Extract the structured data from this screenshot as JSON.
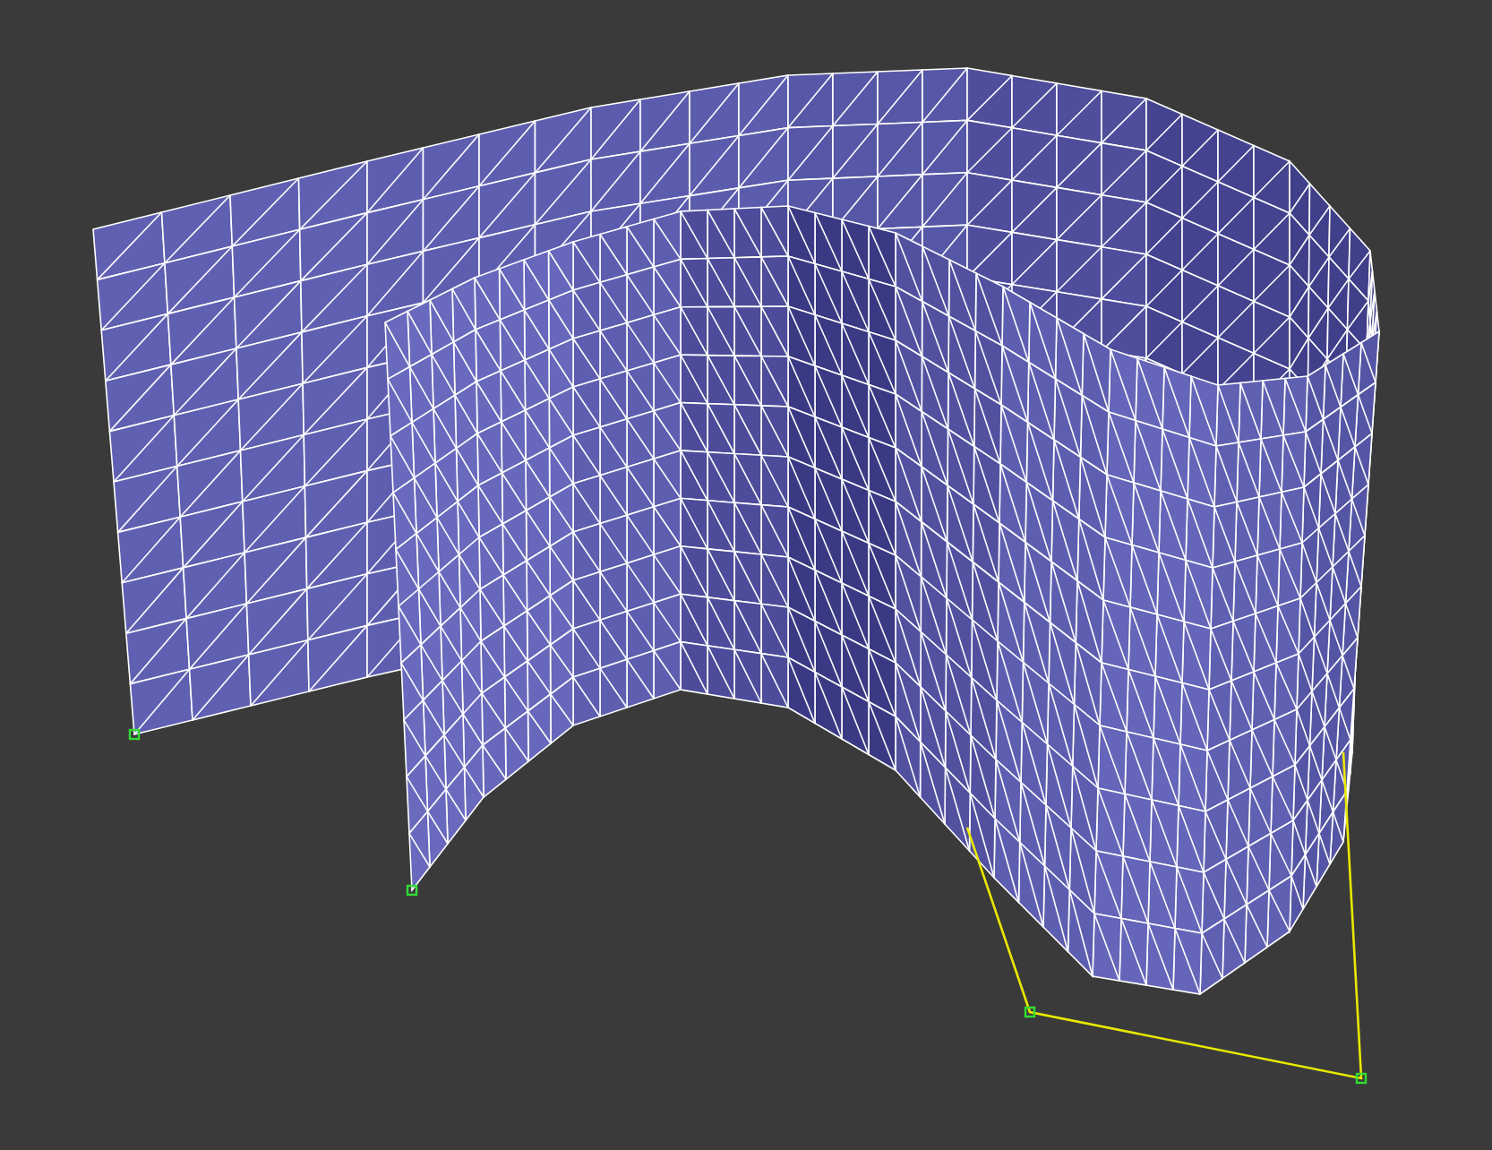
{
  "viewport": {
    "wireframe_on_shaded": true,
    "spline_visible": true
  }
}
